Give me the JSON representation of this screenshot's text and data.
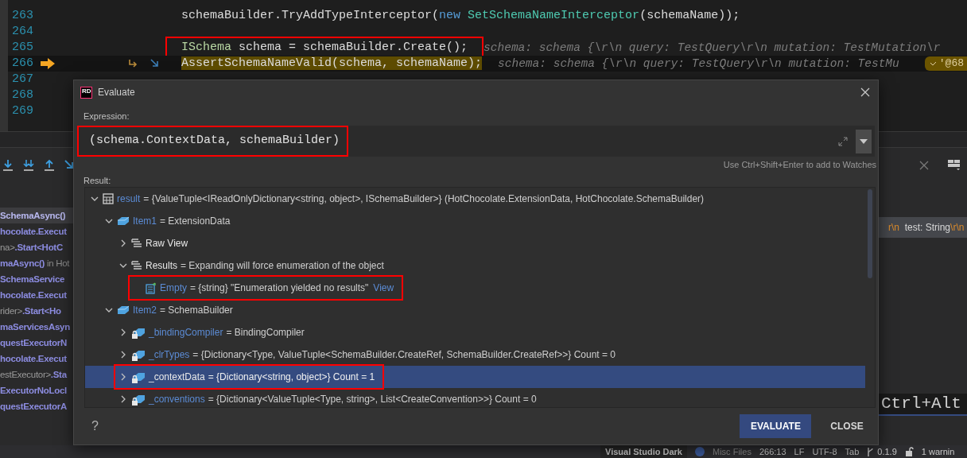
{
  "editor": {
    "lines": [
      {
        "number": "263",
        "tokens": [
          {
            "kind": "plain",
            "text": "schemaBuilder.TryAddTypeInterceptor("
          },
          {
            "kind": "keyword",
            "text": "new"
          },
          {
            "kind": "type",
            "text": " SetSchemaNameInterceptor"
          },
          {
            "kind": "plain",
            "text": "(schemaName));"
          }
        ],
        "current": false,
        "annotated": false
      },
      {
        "number": "264",
        "current": false,
        "annotated": false
      },
      {
        "number": "265",
        "tokens": [
          {
            "kind": "interface",
            "text": "ISchema"
          },
          {
            "kind": "plain",
            "text": " schema = schemaBuilder.Create();"
          }
        ],
        "hint": "schema: schema {\\r\\n  query: TestQuery\\r\\n  mutation: TestMutation\\r",
        "current": false,
        "annotated": true
      },
      {
        "number": "266",
        "tokens": [
          {
            "kind": "plain",
            "text": "AssertSchemaNameValid(schema, schemaName);"
          }
        ],
        "hint": "schema: schema {\\r\\n  query: TestQuery\\r\\n  mutation: TestMu",
        "badge": "'@68",
        "current": true,
        "annotated": false
      },
      {
        "number": "267",
        "current": false,
        "annotated": false
      },
      {
        "number": "268",
        "current": false
      },
      {
        "number": "269",
        "current": false
      }
    ]
  },
  "call_stack": [
    {
      "text": "SchemaAsync()",
      "selected": true
    },
    {
      "text": "hocolate.Execut",
      "selected": false
    },
    {
      "prefix": "na>",
      "text": ".Start<HotC",
      "selected": false
    },
    {
      "text": "maAsync()",
      "suffix": " in Hot",
      "selected": false
    },
    {
      "text": "SchemaService",
      "selected": false
    },
    {
      "text": "hocolate.Execut",
      "selected": false
    },
    {
      "prefix": "rider>",
      "text": ".Start<Ho",
      "selected": false
    },
    {
      "text": "maServicesAsyn",
      "selected": false
    },
    {
      "text": "questExecutorN",
      "selected": false
    },
    {
      "text": "hocolate.Execut",
      "selected": false
    },
    {
      "prefix": "estExecutor>",
      "text": ".Sta",
      "selected": false
    },
    {
      "text": "ExecutorNoLocl",
      "selected": false
    },
    {
      "text": "questExecutorA",
      "selected": false
    }
  ],
  "watch_value": [
    {
      "kind": "escape",
      "text": "r\\n"
    },
    {
      "kind": "plain",
      "text": "  test: String"
    },
    {
      "kind": "escape",
      "text": "\\r\\n"
    }
  ],
  "shortcut_hint": "Ctrl+Alt",
  "dialog": {
    "logo": "RD",
    "title": "Evaluate",
    "expression_label": "Expression:",
    "expression": "(schema.ContextData, schemaBuilder)",
    "expression_annotated": true,
    "hint": "Use Ctrl+Shift+Enter to add to Watches",
    "result_label": "Result:",
    "tree": [
      {
        "kind": "table",
        "name": "result",
        "value": "= {ValueTuple<IReadOnlyDictionary<string, object>, ISchemaBuilder>} (HotChocolate.ExtensionData, HotChocolate.SchemaBuilder)",
        "expandable": true,
        "expanded": true,
        "selected": false,
        "annotated": false,
        "children": [
          {
            "kind": "object",
            "name": "Item1",
            "value": "= ExtensionData",
            "expandable": true,
            "expanded": true,
            "selected": false,
            "annotated": false,
            "children": [
              {
                "kind": "list",
                "name": "Raw View",
                "expandable": true,
                "expanded": false,
                "selected": false,
                "annotated": false
              },
              {
                "kind": "list",
                "name": "Results",
                "value": "= Expanding will force enumeration of the object",
                "expandable": true,
                "expanded": true,
                "selected": false,
                "annotated": false,
                "children": [
                  {
                    "kind": "text",
                    "name": "Empty",
                    "value": "= {string} \"Enumeration yielded no results\"",
                    "link": "View",
                    "expandable": false,
                    "selected": false,
                    "annotated": true
                  }
                ]
              }
            ]
          },
          {
            "kind": "object",
            "name": "Item2",
            "value": "= SchemaBuilder",
            "expandable": true,
            "expanded": true,
            "selected": false,
            "annotated": false,
            "children": [
              {
                "kind": "private",
                "name": "_bindingCompiler",
                "value": "= BindingCompiler",
                "expandable": true,
                "expanded": false,
                "selected": false,
                "annotated": false
              },
              {
                "kind": "private",
                "name": "_clrTypes",
                "value": "= {Dictionary<Type, ValueTuple<SchemaBuilder.CreateRef, SchemaBuilder.CreateRef>>} Count = 0",
                "expandable": true,
                "expanded": false,
                "selected": false,
                "annotated": false
              },
              {
                "kind": "private",
                "name": "_contextData",
                "value": "= {Dictionary<string, object>} Count = 1",
                "expandable": true,
                "expanded": false,
                "selected": true,
                "annotated": true
              },
              {
                "kind": "private",
                "name": "_conventions",
                "value": "= {Dictionary<ValueTuple<Type, string>, List<CreateConvention>>} Count = 0",
                "expandable": true,
                "expanded": false,
                "selected": false,
                "annotated": false
              }
            ]
          }
        ]
      }
    ],
    "help": "?",
    "buttons": [
      {
        "label": "EVALUATE",
        "primary": true
      },
      {
        "label": "CLOSE",
        "primary": false
      }
    ]
  },
  "status_bar": {
    "theme": "Visual Studio Dark",
    "project": "Misc Files",
    "position": "266:13",
    "line_ending": "LF",
    "encoding": "UTF-8",
    "indent": "Tab",
    "branch": "0.1.9",
    "warnings": "1 warnin"
  }
}
